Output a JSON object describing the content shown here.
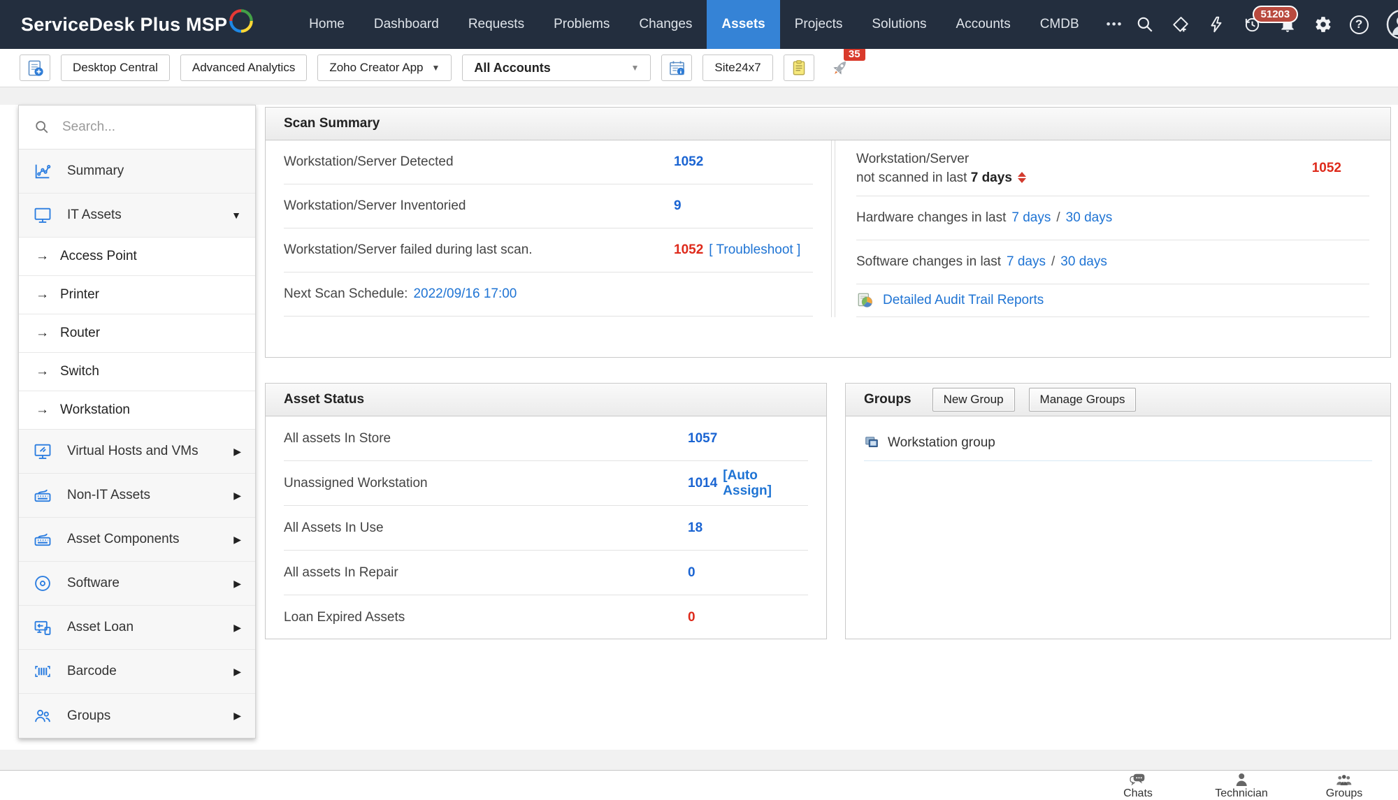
{
  "colors": {
    "navbar_bg": "#232e3e",
    "active_tab": "#3583d6",
    "link_blue": "#1f74d4",
    "value_blue": "#1a64d2",
    "alert_red": "#de2a1b"
  },
  "app": {
    "logo_text": "ServiceDesk Plus MSP"
  },
  "topnav": {
    "items": [
      "Home",
      "Dashboard",
      "Requests",
      "Problems",
      "Changes",
      "Assets",
      "Projects",
      "Solutions",
      "Accounts",
      "CMDB"
    ],
    "active_item": "Assets",
    "more_label": "•••",
    "history_badge": "51203"
  },
  "toolbar": {
    "desktop_central": "Desktop Central",
    "advanced_analytics": "Advanced Analytics",
    "zoho_creator": "Zoho Creator App",
    "accounts_filter": "All Accounts",
    "site24x7": "Site24x7",
    "announcement_badge": "35"
  },
  "sidebar": {
    "search_placeholder": "Search...",
    "items": [
      {
        "label": "Summary"
      },
      {
        "label": "IT Assets"
      },
      {
        "label": "Access Point"
      },
      {
        "label": "Printer"
      },
      {
        "label": "Router"
      },
      {
        "label": "Switch"
      },
      {
        "label": "Workstation"
      },
      {
        "label": "Virtual Hosts and VMs"
      },
      {
        "label": "Non-IT Assets"
      },
      {
        "label": "Asset Components"
      },
      {
        "label": "Software"
      },
      {
        "label": "Asset Loan"
      },
      {
        "label": "Barcode"
      },
      {
        "label": "Groups"
      }
    ]
  },
  "scan_summary": {
    "title": "Scan Summary",
    "detected_label": "Workstation/Server Detected",
    "detected_value": "1052",
    "inventoried_label": "Workstation/Server Inventoried",
    "inventoried_value": "9",
    "failed_label": "Workstation/Server failed during last scan.",
    "failed_value": "1052",
    "failed_action": "[ Troubleshoot ]",
    "next_scan_label": "Next Scan Schedule:",
    "next_scan_value": "2022/09/16 17:00",
    "not_scanned_line1": "Workstation/Server",
    "not_scanned_line2": "not scanned in last",
    "not_scanned_period": "7 days",
    "not_scanned_value": "1052",
    "hardware_label": "Hardware changes in last",
    "software_label": "Software changes in last",
    "period_7": "7 days",
    "period_sep": "/",
    "period_30": "30 days",
    "audit_link": "Detailed Audit Trail Reports"
  },
  "asset_status": {
    "title": "Asset Status",
    "rows": [
      {
        "label": "All assets In Store",
        "value": "1057"
      },
      {
        "label": "Unassigned Workstation",
        "value": "1014",
        "action": "[Auto Assign]"
      },
      {
        "label": "All Assets In Use",
        "value": "18"
      },
      {
        "label": "All assets In Repair",
        "value": "0"
      },
      {
        "label": "Loan Expired Assets",
        "value": "0"
      }
    ]
  },
  "groups_panel": {
    "title": "Groups",
    "new_group": "New Group",
    "manage_groups": "Manage Groups",
    "items": [
      {
        "label": "Workstation group"
      }
    ]
  },
  "statusbar": {
    "chats": "Chats",
    "technician": "Technician",
    "groups": "Groups"
  }
}
